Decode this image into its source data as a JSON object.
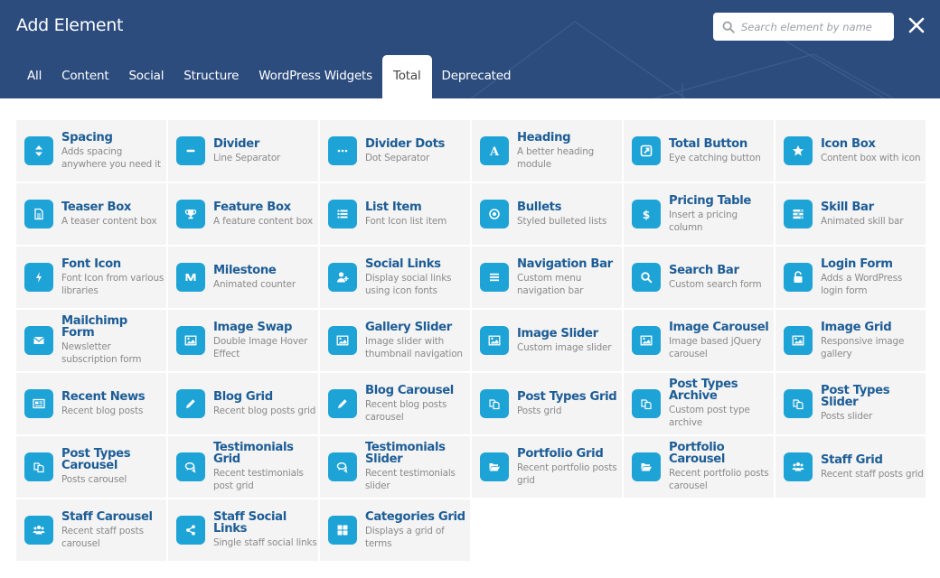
{
  "header": {
    "title": "Add Element",
    "search_placeholder": "Search element by name",
    "close_label": "close",
    "background_color": "#2c4c7e",
    "accent_color": "#1ea3d6"
  },
  "tabs": [
    {
      "label": "All",
      "active": false
    },
    {
      "label": "Content",
      "active": false
    },
    {
      "label": "Social",
      "active": false
    },
    {
      "label": "Structure",
      "active": false
    },
    {
      "label": "WordPress Widgets",
      "active": false
    },
    {
      "label": "Total",
      "active": true
    },
    {
      "label": "Deprecated",
      "active": false
    }
  ],
  "elements": [
    {
      "name": "Spacing",
      "desc": "Adds spacing anywhere you need it",
      "icon": "arrows-vertical-icon"
    },
    {
      "name": "Divider",
      "desc": "Line Separator",
      "icon": "minus-icon"
    },
    {
      "name": "Divider Dots",
      "desc": "Dot Separator",
      "icon": "ellipsis-icon"
    },
    {
      "name": "Heading",
      "desc": "A better heading module",
      "icon": "letter-a-icon"
    },
    {
      "name": "Total Button",
      "desc": "Eye catching button",
      "icon": "external-link-icon"
    },
    {
      "name": "Icon Box",
      "desc": "Content box with icon",
      "icon": "star-icon"
    },
    {
      "name": "Teaser Box",
      "desc": "A teaser content box",
      "icon": "document-icon"
    },
    {
      "name": "Feature Box",
      "desc": "A feature content box",
      "icon": "trophy-icon"
    },
    {
      "name": "List Item",
      "desc": "Font Icon list item",
      "icon": "list-icon"
    },
    {
      "name": "Bullets",
      "desc": "Styled bulleted lists",
      "icon": "dot-circle-icon"
    },
    {
      "name": "Pricing Table",
      "desc": "Insert a pricing column",
      "icon": "dollar-icon"
    },
    {
      "name": "Skill Bar",
      "desc": "Animated skill bar",
      "icon": "tasks-icon"
    },
    {
      "name": "Font Icon",
      "desc": "Font Icon from various libraries",
      "icon": "bolt-icon"
    },
    {
      "name": "Milestone",
      "desc": "Animated counter",
      "icon": "medium-icon"
    },
    {
      "name": "Social Links",
      "desc": "Display social links using icon fonts",
      "icon": "user-plus-icon"
    },
    {
      "name": "Navigation Bar",
      "desc": "Custom menu navigation bar",
      "icon": "bars-icon"
    },
    {
      "name": "Search Bar",
      "desc": "Custom search form",
      "icon": "search-icon"
    },
    {
      "name": "Login Form",
      "desc": "Adds a WordPress login form",
      "icon": "unlock-icon"
    },
    {
      "name": "Mailchimp Form",
      "desc": "Newsletter subscription form",
      "icon": "envelope-icon"
    },
    {
      "name": "Image Swap",
      "desc": "Double Image Hover Effect",
      "icon": "image-icon"
    },
    {
      "name": "Gallery Slider",
      "desc": "Image slider with thumbnail navigation",
      "icon": "image-icon"
    },
    {
      "name": "Image Slider",
      "desc": "Custom image slider",
      "icon": "image-icon"
    },
    {
      "name": "Image Carousel",
      "desc": "Image based jQuery carousel",
      "icon": "image-icon"
    },
    {
      "name": "Image Grid",
      "desc": "Responsive image gallery",
      "icon": "image-icon"
    },
    {
      "name": "Recent News",
      "desc": "Recent blog posts",
      "icon": "newspaper-icon"
    },
    {
      "name": "Blog Grid",
      "desc": "Recent blog posts grid",
      "icon": "pencil-icon"
    },
    {
      "name": "Blog Carousel",
      "desc": "Recent blog posts carousel",
      "icon": "pencil-icon"
    },
    {
      "name": "Post Types Grid",
      "desc": "Posts grid",
      "icon": "files-icon"
    },
    {
      "name": "Post Types Archive",
      "desc": "Custom post type archive",
      "icon": "files-icon"
    },
    {
      "name": "Post Types Slider",
      "desc": "Posts slider",
      "icon": "files-icon"
    },
    {
      "name": "Post Types Carousel",
      "desc": "Posts carousel",
      "icon": "files-icon"
    },
    {
      "name": "Testimonials Grid",
      "desc": "Recent testimonials post grid",
      "icon": "comments-icon"
    },
    {
      "name": "Testimonials Slider",
      "desc": "Recent testimonials slider",
      "icon": "comments-icon"
    },
    {
      "name": "Portfolio Grid",
      "desc": "Recent portfolio posts grid",
      "icon": "folder-open-icon"
    },
    {
      "name": "Portfolio Carousel",
      "desc": "Recent portfolio posts carousel",
      "icon": "folder-open-icon"
    },
    {
      "name": "Staff Grid",
      "desc": "Recent staff posts grid",
      "icon": "users-icon"
    },
    {
      "name": "Staff Carousel",
      "desc": "Recent staff posts carousel",
      "icon": "users-icon"
    },
    {
      "name": "Staff Social Links",
      "desc": "Single staff social links",
      "icon": "share-icon"
    },
    {
      "name": "Categories Grid",
      "desc": "Displays a grid of terms",
      "icon": "th-large-icon"
    }
  ]
}
